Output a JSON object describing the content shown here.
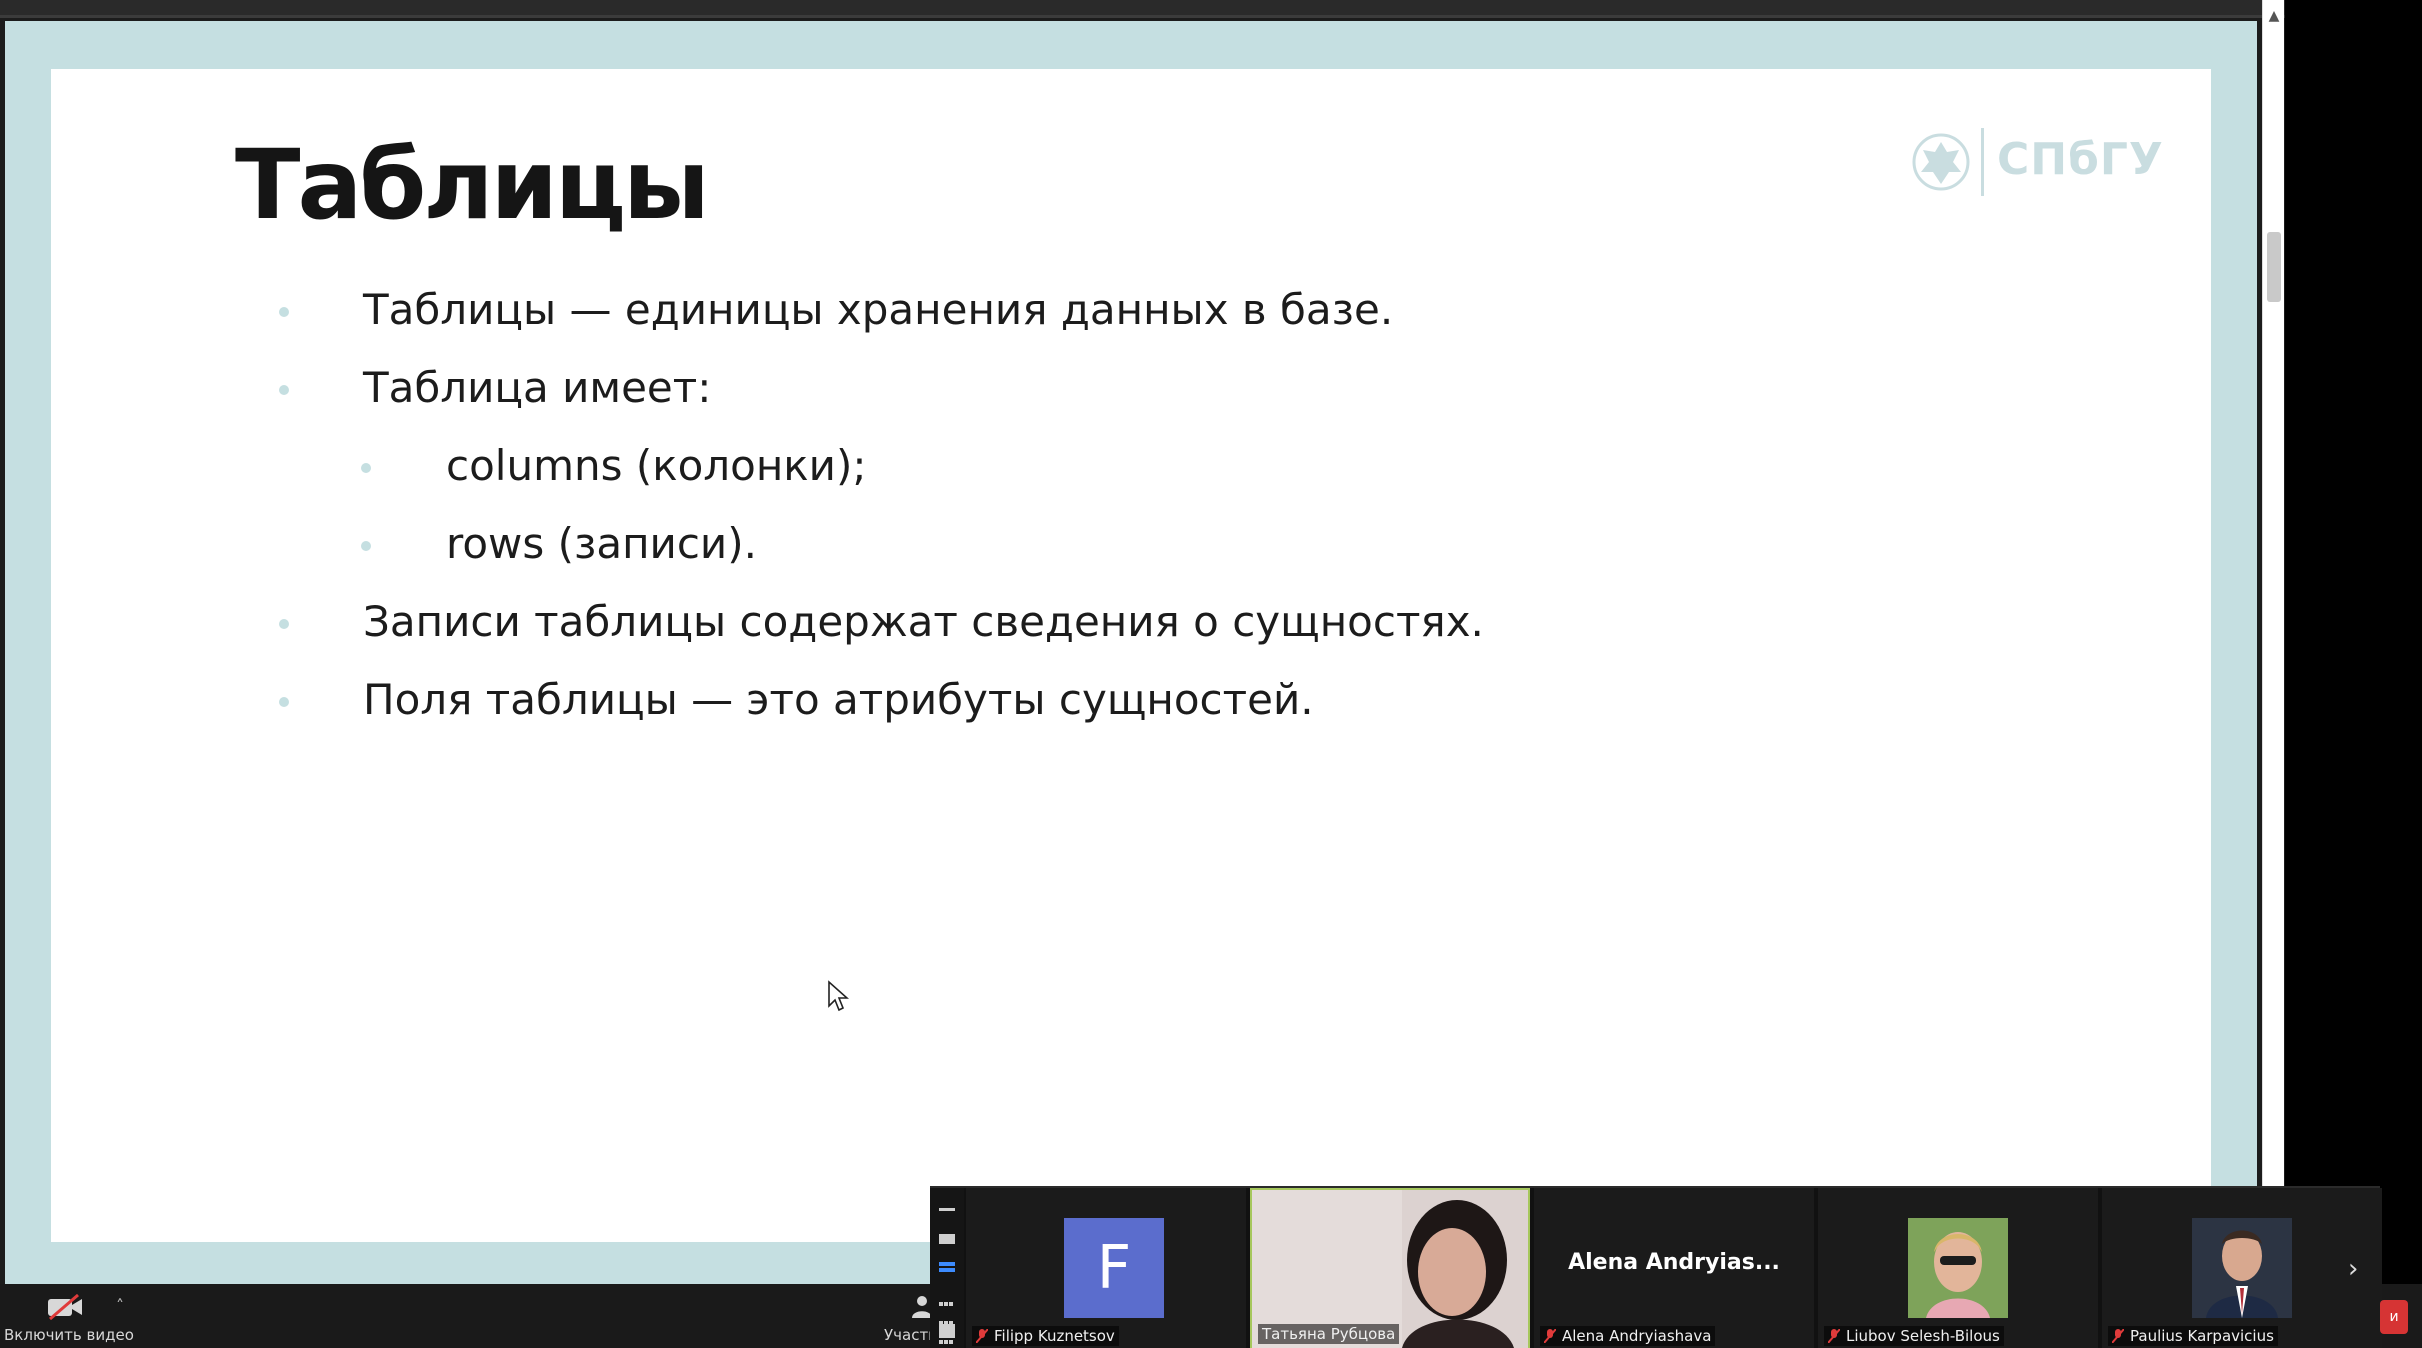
{
  "slide": {
    "title": "Таблицы",
    "logo_text": "СПбГУ",
    "bullets": [
      {
        "level": 1,
        "text": "Таблицы — единицы хранения данных в базе."
      },
      {
        "level": 1,
        "text": "Таблица имеет:"
      },
      {
        "level": 2,
        "text": "columns (колонки);"
      },
      {
        "level": 2,
        "text": "rows (записи)."
      },
      {
        "level": 1,
        "text": "Записи таблицы содержат сведения о сущностях."
      },
      {
        "level": 1,
        "text": "Поля таблицы — это атрибуты сущностей."
      }
    ]
  },
  "toolbar": {
    "video_label": "Включить видео",
    "participants_label": "Участн",
    "badge_text": "и"
  },
  "gallery": {
    "tiles": [
      {
        "name": "Filipp Kuznetsov",
        "avatar_letter": "F",
        "muted": true
      },
      {
        "name": "Татьяна Рубцова",
        "active": true,
        "muted": false
      },
      {
        "name": "Alena Andryiashava",
        "display_name": "Alena  Andryias...",
        "muted": true
      },
      {
        "name": "Liubov Selesh-Bilous",
        "muted": true
      },
      {
        "name": "Paulius Karpavicius",
        "muted": true
      }
    ]
  },
  "colors": {
    "share_background": "#c5dfe1",
    "bullet_dot": "#c5dfe1",
    "avatar_f": "#5b6dcd",
    "active_border": "#a6c75c"
  }
}
